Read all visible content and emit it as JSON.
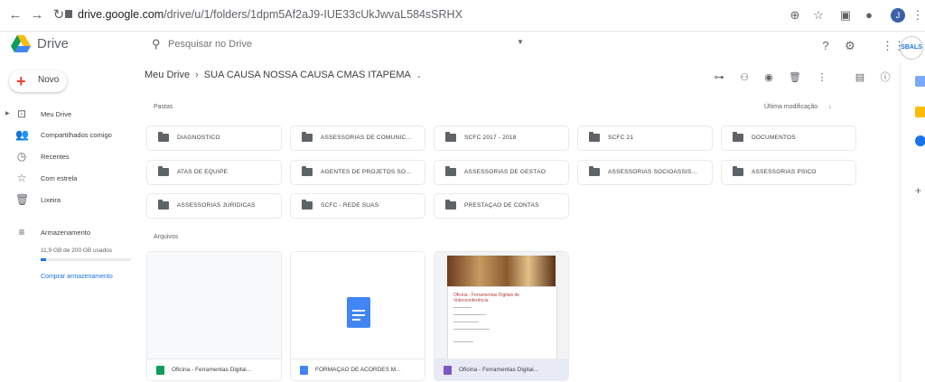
{
  "browser": {
    "url_host": "drive.google.com",
    "url_path": "/drive/u/1/folders/1dpm5Af2aJ9-IUE33cUkJwvaL584sSRHX",
    "profile_initial": "J"
  },
  "header": {
    "brand": "Drive",
    "search_placeholder": "Pesquisar no Drive",
    "avatar_text": "SBALS"
  },
  "sidebar": {
    "new_label": "Novo",
    "items": [
      {
        "label": "Meu Drive",
        "icon": "drive-icon"
      },
      {
        "label": "Compartilhados comigo",
        "icon": "people-icon"
      },
      {
        "label": "Recentes",
        "icon": "clock-icon"
      },
      {
        "label": "Com estrela",
        "icon": "star-icon"
      },
      {
        "label": "Lixeira",
        "icon": "trash-icon"
      },
      {
        "label": "Armazenamento",
        "icon": "storage-icon"
      }
    ],
    "storage_text": "11,9 GB de 200 GB usados",
    "storage_fraction": 0.06,
    "buy_storage": "Comprar armazenamento"
  },
  "main": {
    "breadcrumb_root": "Meu Drive",
    "breadcrumb_separator": "›",
    "breadcrumb_current": "SUA CAUSA NOSSA CAUSA CMAS ITAPEMA",
    "folders_label": "Pastas",
    "sort_label": "Última modificação",
    "files_label": "Arquivos",
    "folders": [
      "DIAGNÓSTICO",
      "ASSESSORIAS DE COMUNIC...",
      "SCFC 2017 - 2018",
      "SCFC 21",
      "DOCUMENTOS",
      "ATAS DE EQUIPE",
      "AGENTES DE PROJETOS SO...",
      "ASSESSORIAS DE GESTÃO",
      "ASSESSORIAS SOCIOASSIS...",
      "ASSESSORIAS PSICO",
      "ASSESSORIAS JURÍDICAS",
      "SCFC - REDE SUAS",
      "PRESTAÇÃO DE CONTAS"
    ],
    "files": [
      {
        "name": "Oficina - Ferramentas Digitai...",
        "icon": "sheets-icon",
        "color": "#0f9d58"
      },
      {
        "name": "FORMAÇÃO DE ACORDES M...",
        "icon": "docs-icon",
        "color": "#4285f4"
      },
      {
        "name": "Oficina - Ferramentas Digitai...",
        "icon": "slides-icon",
        "color": "#7e57c2"
      }
    ],
    "slide_title": "Oficina - Ferramentas Digitais de Videoconferência"
  },
  "colors": {
    "accent": "#1a73e8",
    "folder": "#5f6368"
  }
}
